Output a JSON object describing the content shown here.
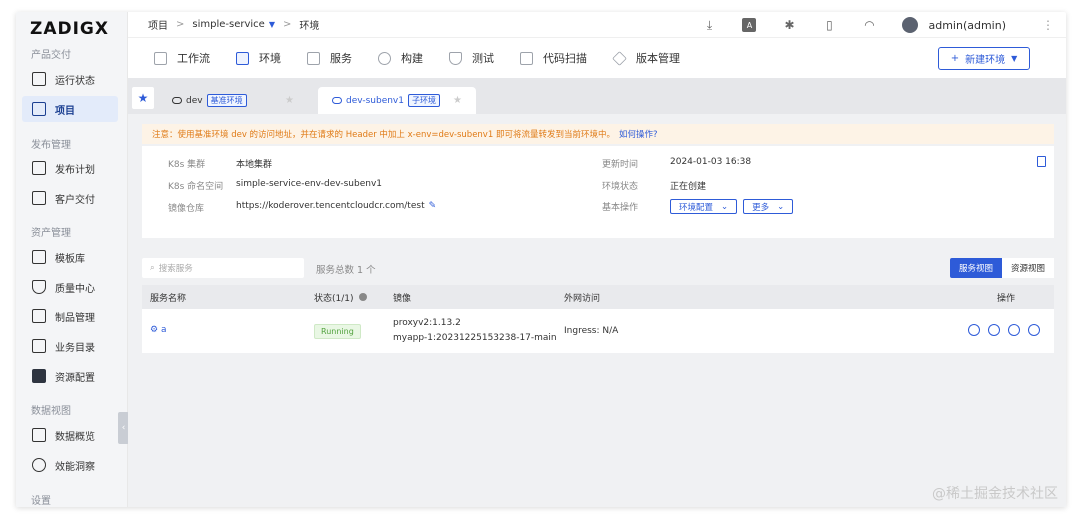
{
  "logo": "ZADIGX",
  "sidebar": {
    "sections": [
      {
        "label": "产品交付"
      },
      {
        "label": "发布管理"
      },
      {
        "label": "资产管理"
      },
      {
        "label": "数据视图"
      },
      {
        "label": "设置"
      }
    ],
    "items": [
      {
        "label": "运行状态",
        "icon": "pulse-icon"
      },
      {
        "label": "项目",
        "icon": "project-icon",
        "active": true
      },
      {
        "label": "发布计划",
        "icon": "plan-icon"
      },
      {
        "label": "客户交付",
        "icon": "delivery-icon"
      },
      {
        "label": "模板库",
        "icon": "template-icon"
      },
      {
        "label": "质量中心",
        "icon": "flask-icon"
      },
      {
        "label": "制品管理",
        "icon": "artifact-icon"
      },
      {
        "label": "业务目录",
        "icon": "catalog-icon"
      },
      {
        "label": "资源配置",
        "icon": "gear-icon"
      },
      {
        "label": "数据概览",
        "icon": "chart-icon"
      },
      {
        "label": "效能洞察",
        "icon": "pie-icon"
      }
    ]
  },
  "breadcrumb": {
    "root": "项目",
    "sep1": ">",
    "project": "simple-service",
    "sep2": ">",
    "current": "环境"
  },
  "user": {
    "name": "admin(admin)"
  },
  "nav_tabs": [
    {
      "label": "工作流"
    },
    {
      "label": "环境",
      "active": true
    },
    {
      "label": "服务"
    },
    {
      "label": "构建"
    },
    {
      "label": "测试"
    },
    {
      "label": "代码扫描"
    },
    {
      "label": "版本管理"
    }
  ],
  "new_env_button": "新建环境",
  "env_tabs": [
    {
      "name": "dev",
      "badge": "基准环境"
    },
    {
      "name": "dev-subenv1",
      "badge": "子环境",
      "active": true
    }
  ],
  "notice": {
    "text": "注意：使用基准环境 dev 的访问地址，并在请求的 Header 中加上 x-env=dev-subenv1 即可将流量转发到当前环境中。",
    "link": "如何操作?"
  },
  "info": {
    "cluster_label": "K8s 集群",
    "cluster_value": "本地集群",
    "namespace_label": "K8s 命名空间",
    "namespace_value": "simple-service-env-dev-subenv1",
    "registry_label": "镜像仓库",
    "registry_value": "https://koderover.tencentcloudcr.com/test",
    "updated_label": "更新时间",
    "updated_value": "2024-01-03 16:38",
    "status_label": "环境状态",
    "status_value": "正在创建",
    "ops_label": "基本操作",
    "env_config_btn": "环境配置",
    "more_btn": "更多"
  },
  "service_list": {
    "search_placeholder": "搜索服务",
    "count_label": "服务总数 1 个",
    "view_service": "服务视图",
    "view_resource": "资源视图",
    "columns": [
      "服务名称",
      "状态(1/1)",
      "镜像",
      "外网访问",
      "操作"
    ],
    "rows": [
      {
        "name": "a",
        "status": "Running",
        "image1": "proxyv2:1.13.2",
        "image2": "myapp-1:20231225153238-17-main",
        "ingress": "Ingress: N/A"
      }
    ]
  },
  "watermark": "@稀土掘金技术社区",
  "colors": {
    "accent": "#2e5bd8",
    "warning": "#e07b17",
    "success": "#52a23e"
  }
}
